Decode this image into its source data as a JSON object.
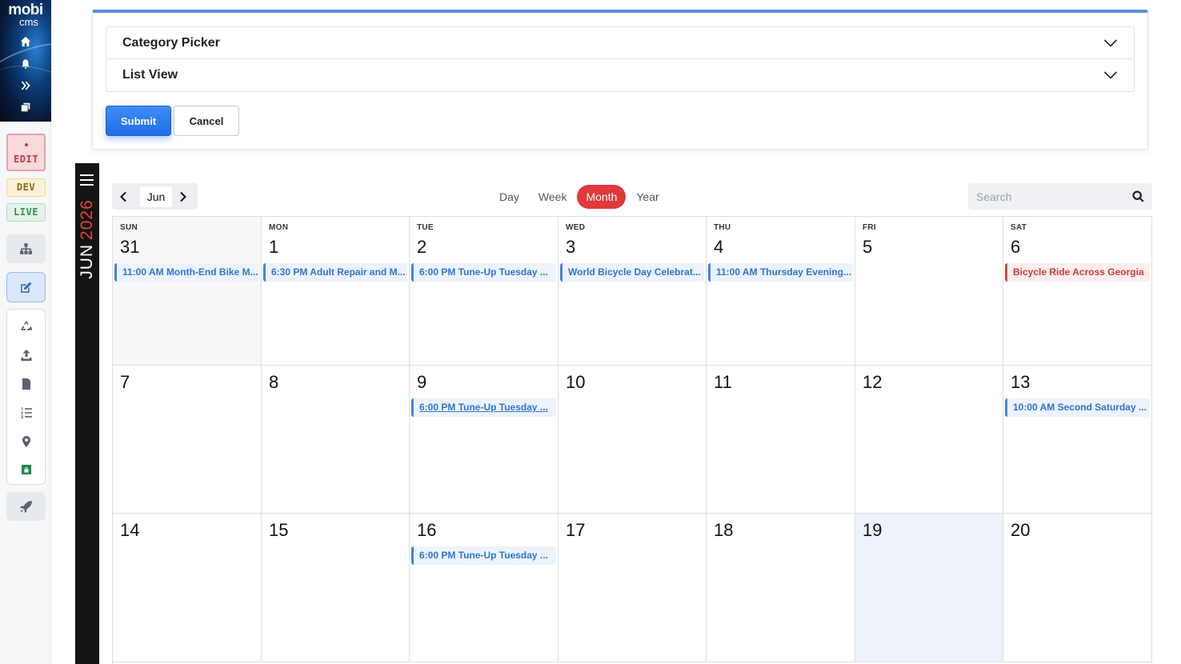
{
  "rail": {
    "logo_line1": "mobi",
    "logo_line2": "cms",
    "top_icons": [
      "home-icon",
      "bell-icon",
      "double-chevron-right-icon",
      "copy-icon"
    ],
    "env_edit": "EDIT",
    "env_dev": "DEV",
    "env_live": "LIVE",
    "tools": [
      "sitemap-icon",
      "edit-icon",
      "recycle-icon",
      "upload-icon",
      "file-icon",
      "ordered-list-icon",
      "map-pin-icon",
      "lock-icon",
      "rocket-icon"
    ]
  },
  "form": {
    "accordion": [
      {
        "title": "Category Picker"
      },
      {
        "title": "List View"
      }
    ],
    "submit_label": "Submit",
    "cancel_label": "Cancel"
  },
  "calendar": {
    "strip_month": "JUN",
    "strip_year": "2026",
    "nav_month": "Jun",
    "views": [
      "Day",
      "Week",
      "Month",
      "Year"
    ],
    "active_view": "Month",
    "search_placeholder": "Search",
    "weekdays": [
      "SUN",
      "MON",
      "TUE",
      "WED",
      "THU",
      "FRI",
      "SAT"
    ],
    "weeks": [
      [
        "31",
        "1",
        "2",
        "3",
        "4",
        "5",
        "6"
      ],
      [
        "7",
        "8",
        "9",
        "10",
        "11",
        "12",
        "13"
      ],
      [
        "14",
        "15",
        "16",
        "17",
        "18",
        "19",
        "20"
      ]
    ],
    "events": [
      {
        "week": 0,
        "day": 0,
        "time": "11:00 AM",
        "title": "Month-End Bike M...",
        "style": "blue"
      },
      {
        "week": 0,
        "day": 1,
        "time": "6:30 PM",
        "title": "Adult Repair and M...",
        "style": "blue"
      },
      {
        "week": 0,
        "day": 2,
        "time": "6:00 PM",
        "title": "Tune-Up Tuesday ...",
        "style": "blue"
      },
      {
        "week": 0,
        "day": 3,
        "time": "",
        "title": "World Bicycle Day Celebrat...",
        "style": "blue"
      },
      {
        "week": 0,
        "day": 4,
        "time": "11:00 AM",
        "title": "Thursday Evening...",
        "style": "blue"
      },
      {
        "week": 0,
        "day": 6,
        "time": "",
        "title": "Bicycle Ride Across Georgia",
        "style": "red"
      },
      {
        "week": 1,
        "day": 2,
        "time": "6:00 PM",
        "title": "Tune-Up Tuesday ...",
        "style": "link"
      },
      {
        "week": 1,
        "day": 6,
        "time": "10:00 AM",
        "title": "Second Saturday ...",
        "style": "blue"
      },
      {
        "week": 2,
        "day": 2,
        "time": "6:00 PM",
        "title": "Tune-Up Tuesday ...",
        "style": "blue"
      }
    ],
    "outside_days": [
      "31"
    ],
    "today": "19",
    "colors": {
      "accent": "#e0383b",
      "event_blue": "#2e76d1",
      "event_red": "#d03a3a",
      "today_bg": "#edf2fb"
    }
  }
}
